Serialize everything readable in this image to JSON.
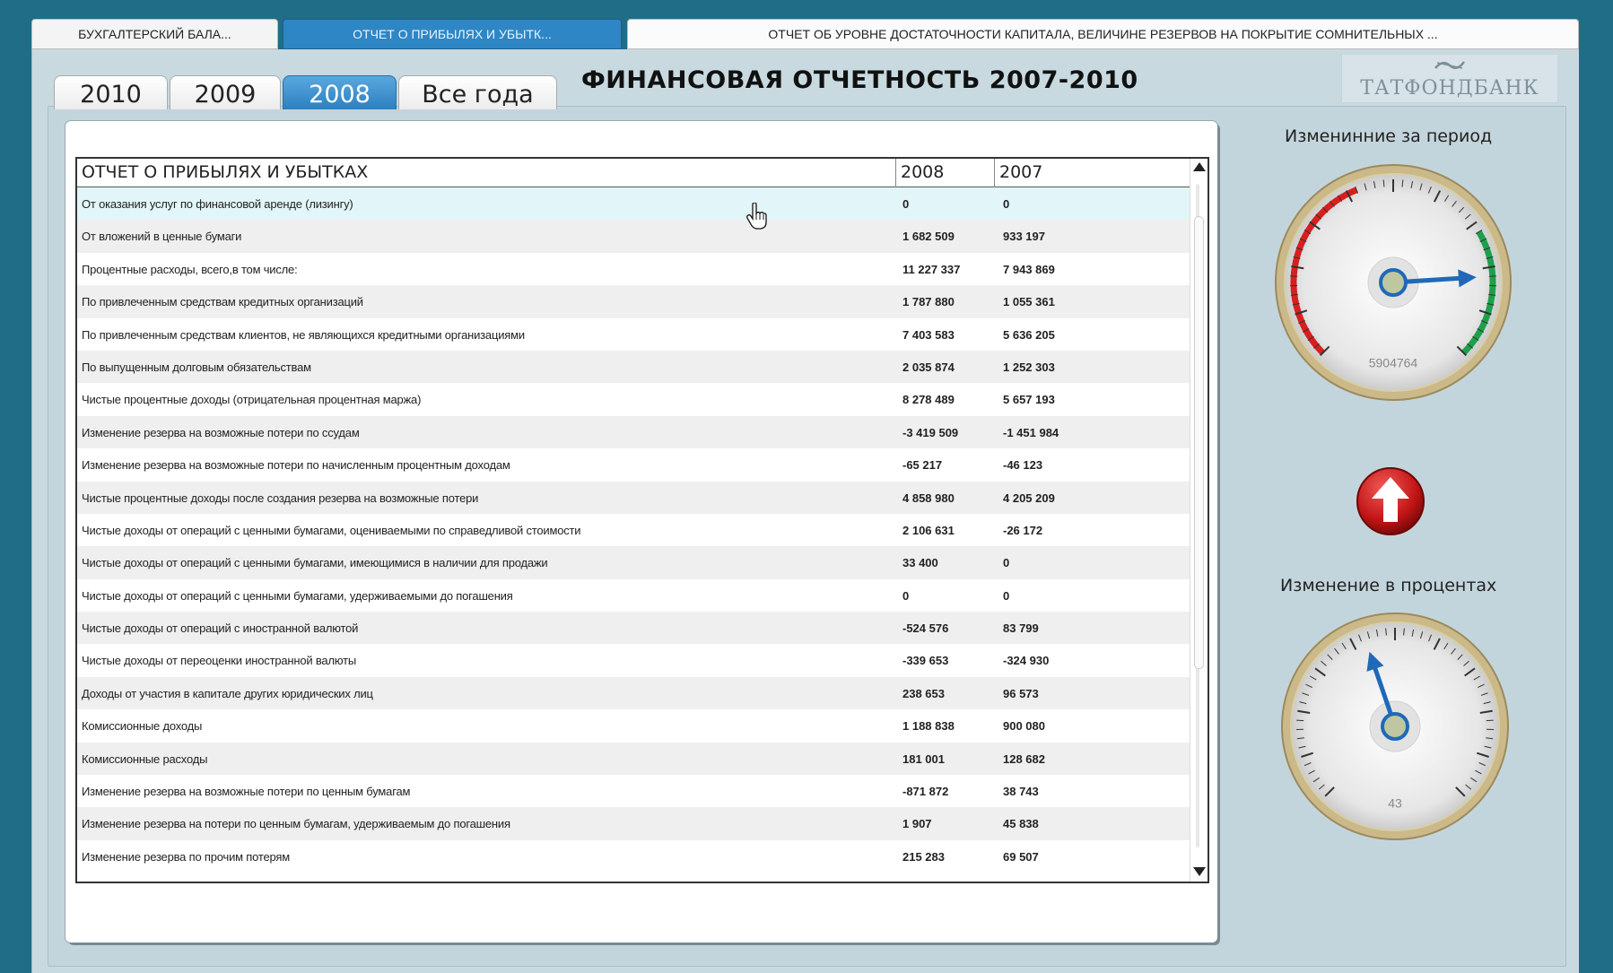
{
  "top_tabs": [
    {
      "label": "БУХГАЛТЕРСКИЙ БАЛА..."
    },
    {
      "label": "ОТЧЕТ О ПРИБЫЛЯХ И УБЫТК..."
    },
    {
      "label": "ОТЧЕТ ОБ УРОВНЕ ДОСТАТОЧНОСТИ КАПИТАЛА, ВЕЛИЧИНЕ РЕЗЕРВОВ  НА ПОКРЫТИЕ СОМНИТЕЛЬНЫХ ..."
    }
  ],
  "year_tabs": [
    {
      "label": "2010"
    },
    {
      "label": "2009"
    },
    {
      "label": "2008"
    },
    {
      "label": "Все года"
    }
  ],
  "active_year": "2008",
  "title": "ФИНАНСОВАЯ ОТЧЕТНОСТЬ 2007-2010",
  "logo": {
    "mark": "ꗃ",
    "text": "ТАТФОНДБАНК"
  },
  "table": {
    "header": {
      "name": "ОТЧЕТ О ПРИБЫЛЯХ И УБЫТКАХ",
      "col1": "2008",
      "col2": "2007"
    },
    "rows": [
      {
        "name": "От оказания услуг по финансовой аренде (лизингу)",
        "v1": "0",
        "v2": "0"
      },
      {
        "name": "От вложений в ценные бумаги",
        "v1": "1 682 509",
        "v2": "933 197"
      },
      {
        "name": "Процентные расходы, всего,в том числе:",
        "v1": "11 227 337",
        "v2": "7 943 869"
      },
      {
        "name": "По привлеченным средствам кредитных организаций",
        "v1": "1 787 880",
        "v2": "1 055 361"
      },
      {
        "name": "По привлеченным средствам клиентов, не являющихся кредитными организациями",
        "v1": "7 403 583",
        "v2": "5 636 205"
      },
      {
        "name": "По выпущенным долговым обязательствам",
        "v1": "2 035 874",
        "v2": "1 252 303"
      },
      {
        "name": "Чистые процентные доходы (отрицательная процентная маржа)",
        "v1": "8 278 489",
        "v2": "5 657 193"
      },
      {
        "name": "Изменение резерва на возможные потери по ссудам",
        "v1": "-3 419 509",
        "v2": "-1 451 984"
      },
      {
        "name": "Изменение резерва на возможные потери по начисленным процентным доходам",
        "v1": "-65 217",
        "v2": "-46 123"
      },
      {
        "name": "Чистые процентные доходы после создания резерва на возможные потери",
        "v1": "4 858 980",
        "v2": "4 205 209"
      },
      {
        "name": "Чистые доходы от операций с ценными бумагами, оцениваемыми по справедливой стоимости",
        "v1": "2 106 631",
        "v2": "-26 172"
      },
      {
        "name": "Чистые доходы от операций с ценными бумагами, имеющимися в наличии для продажи",
        "v1": "33 400",
        "v2": "0"
      },
      {
        "name": "Чистые доходы от операций с ценными бумагами, удерживаемыми до погашения",
        "v1": "0",
        "v2": "0"
      },
      {
        "name": "Чистые доходы от операций с иностранной валютой",
        "v1": "-524 576",
        "v2": "83 799"
      },
      {
        "name": "Чистые доходы от переоценки иностранной валюты",
        "v1": "-339 653",
        "v2": "-324 930"
      },
      {
        "name": "Доходы от участия в капитале других юридических лиц",
        "v1": "238 653",
        "v2": "96 573"
      },
      {
        "name": "Комиссионные доходы",
        "v1": "1 188 838",
        "v2": "900 080"
      },
      {
        "name": "Комиссионные расходы",
        "v1": "181 001",
        "v2": "128 682"
      },
      {
        "name": "Изменение резерва на возможные потери по ценным бумагам",
        "v1": "-871 872",
        "v2": "38 743"
      },
      {
        "name": "Изменение резерва на  потери по ценным бумагам, удерживаемым до погашения",
        "v1": "1 907",
        "v2": "45 838"
      },
      {
        "name": "Изменение резерва по прочим потерям",
        "v1": "215 283",
        "v2": "69 507"
      }
    ]
  },
  "gauge_period": {
    "label": "Изменинние за период",
    "value": "5904764",
    "needle_fraction": 0.82
  },
  "gauge_percent": {
    "label": "Изменение в процентах",
    "value": "43",
    "needle_fraction": 0.43
  },
  "colors": {
    "accent": "#2f86c4",
    "gauge_red": "#d81e1e",
    "gauge_green": "#1ea04a",
    "up_button": "#c21414"
  },
  "icons": {
    "up_button": "arrow-up-icon",
    "cursor": "hand-pointer-icon"
  }
}
